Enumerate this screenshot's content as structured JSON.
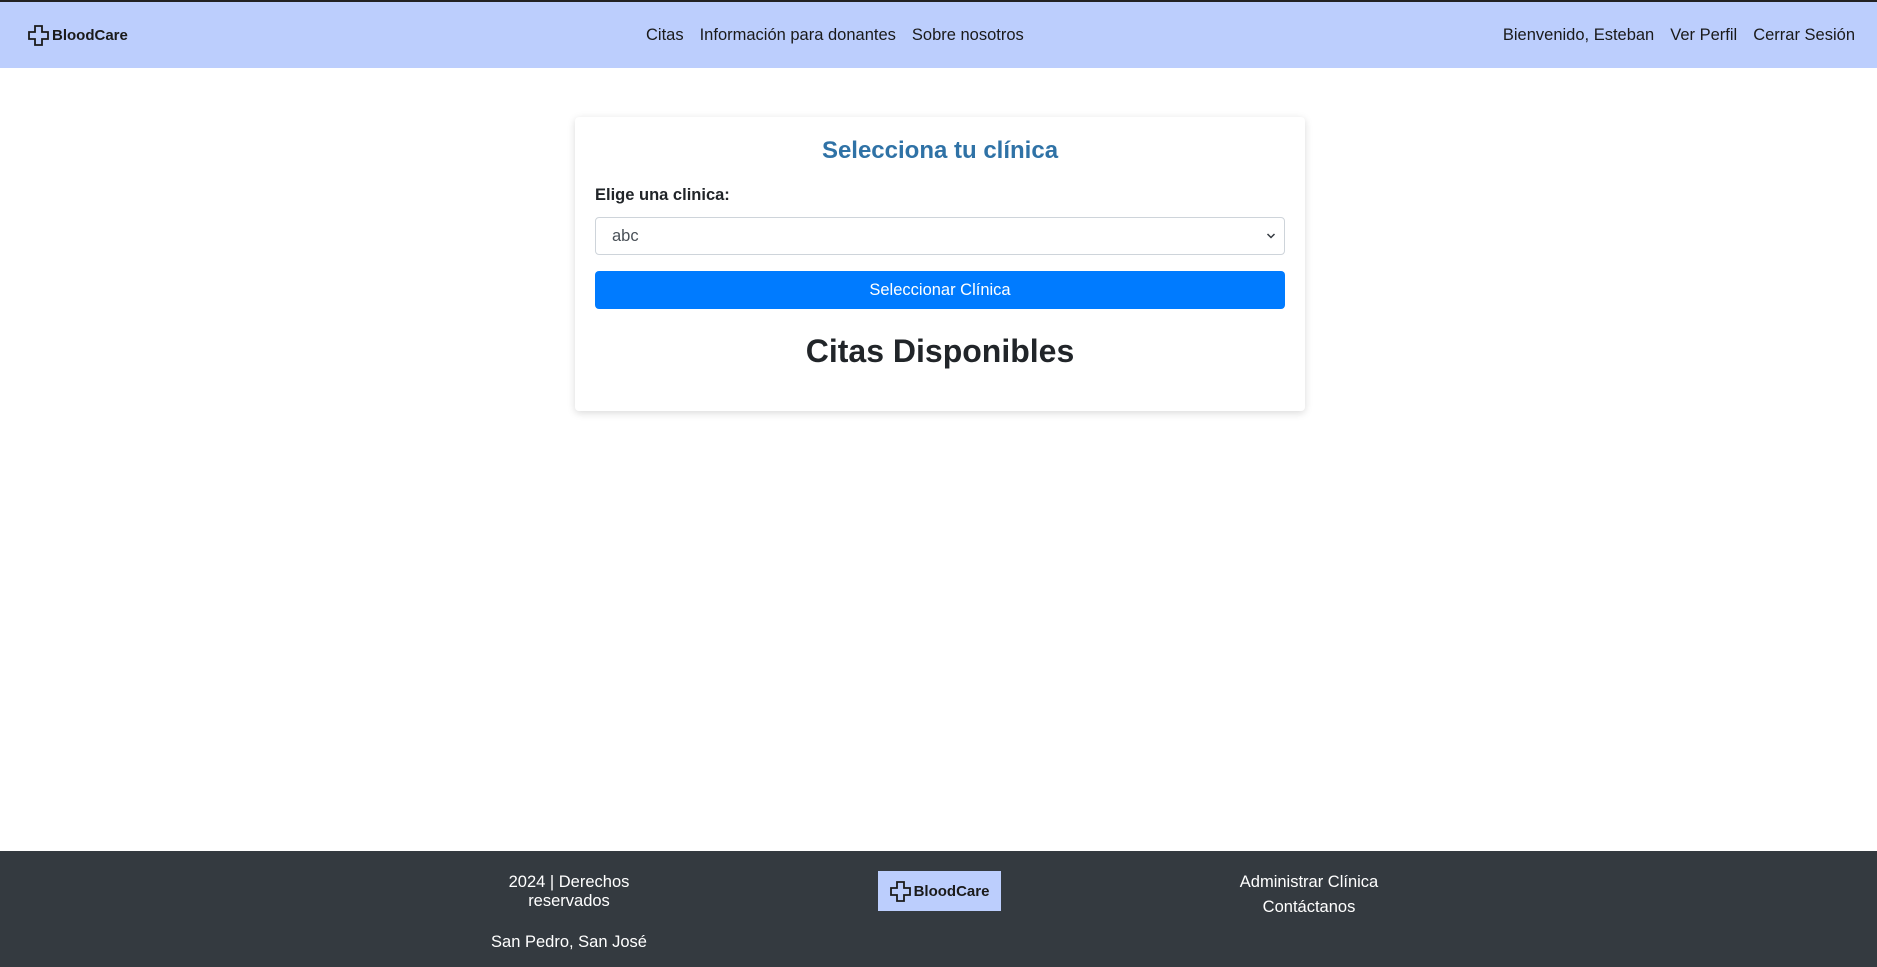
{
  "header": {
    "brand": "BloodCare",
    "nav_center": [
      "Citas",
      "Información para donantes",
      "Sobre nosotros"
    ],
    "nav_right": [
      "Bienvenido, Esteban",
      "Ver Perfil",
      "Cerrar Sesión"
    ]
  },
  "card": {
    "title": "Selecciona tu clínica",
    "field_label": "Elige una clinica:",
    "select_value": "abc",
    "button_label": "Seleccionar Clínica",
    "section_title": "Citas Disponibles"
  },
  "footer": {
    "copyright": "2024 | Derechos reservados",
    "location": "San Pedro, San José",
    "logo_text": "BloodCare",
    "links": [
      "Administrar Clínica",
      "Contáctanos"
    ]
  },
  "colors": {
    "header_bg": "#bccefd",
    "primary_button": "#007bff",
    "title_blue": "#2f72a6",
    "footer_bg": "#343a40"
  },
  "icons": {
    "brand_icon": "medical-cross-icon",
    "select_icon": "chevron-down-icon"
  }
}
